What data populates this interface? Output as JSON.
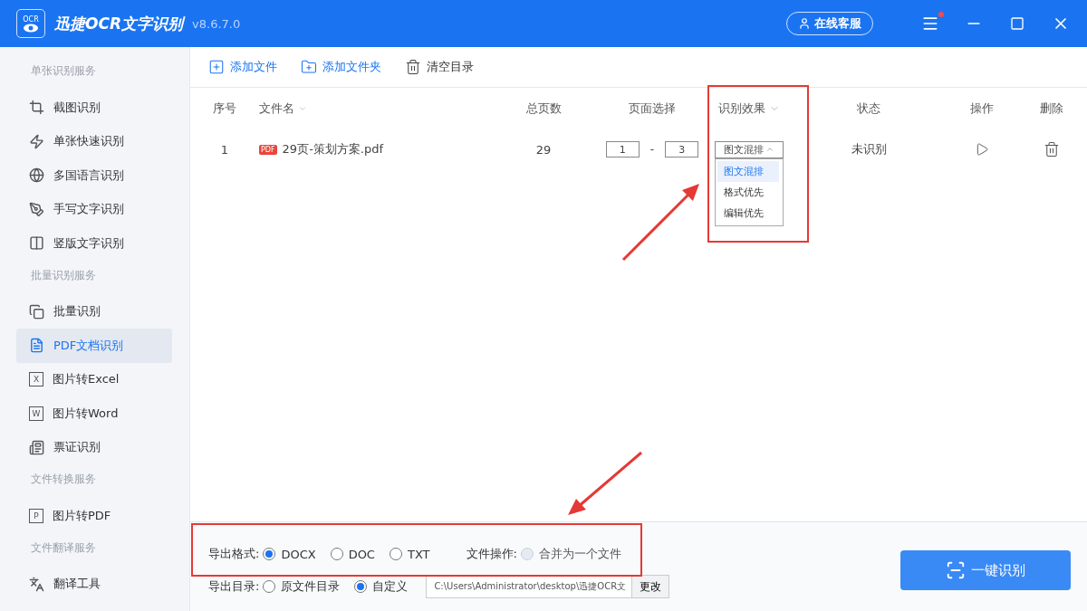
{
  "window": {
    "logo_text": "OCR",
    "title": "迅捷OCR文字识别",
    "version": "v8.6.7.0",
    "support_button": "在线客服",
    "menu_badge": true
  },
  "sidebar": {
    "sections": [
      {
        "heading": "单张识别服务",
        "items": [
          {
            "label": "截图识别",
            "selected": false
          },
          {
            "label": "单张快速识别",
            "selected": false
          },
          {
            "label": "多国语言识别",
            "selected": false
          },
          {
            "label": "手写文字识别",
            "selected": false
          },
          {
            "label": "竖版文字识别",
            "selected": false
          }
        ]
      },
      {
        "heading": "批量识别服务",
        "items": [
          {
            "label": "批量识别",
            "selected": false
          },
          {
            "label": "PDF文档识别",
            "selected": true
          },
          {
            "label": "图片转Excel",
            "selected": false,
            "icon_letter": "X"
          },
          {
            "label": "图片转Word",
            "selected": false,
            "icon_letter": "W"
          },
          {
            "label": "票证识别",
            "selected": false
          }
        ]
      },
      {
        "heading": "文件转换服务",
        "items": [
          {
            "label": "图片转PDF",
            "selected": false,
            "icon_letter": "P"
          }
        ]
      },
      {
        "heading": "文件翻译服务",
        "items": [
          {
            "label": "翻译工具",
            "selected": false
          }
        ]
      }
    ]
  },
  "toolbar": [
    "添加文件",
    "添加文件夹",
    "清空目录"
  ],
  "table": {
    "columns": [
      "序号",
      "文件名",
      "总页数",
      "页面选择",
      "识别效果",
      "状态",
      "操作",
      "删除"
    ],
    "rows": [
      {
        "index": "1",
        "file_badge": "PDF",
        "file": "29页-策划方案.pdf",
        "pages": "29",
        "page_from": "1",
        "range_sep": "-",
        "page_to": "3",
        "mode": "图文混排",
        "status": "未识别"
      }
    ]
  },
  "dropdown": {
    "options": [
      {
        "label": "图文混排",
        "selected": true
      },
      {
        "label": "格式优先",
        "selected": false
      },
      {
        "label": "编辑优先",
        "selected": false
      }
    ]
  },
  "export": {
    "format_label": "导出格式:",
    "formats": [
      {
        "label": "DOCX",
        "selected": true
      },
      {
        "label": "DOC",
        "selected": false
      },
      {
        "label": "TXT",
        "selected": false
      }
    ],
    "file_op_label": "文件操作:",
    "merge": {
      "label": "合并为一个文件",
      "checked": false,
      "disabled": true
    },
    "dir_label": "导出目录:",
    "dirs": [
      {
        "label": "原文件目录",
        "selected": false
      },
      {
        "label": "自定义",
        "selected": true
      }
    ],
    "path": "C:\\Users\\Administrator\\desktop\\迅捷OCR文",
    "change_button": "更改"
  },
  "start_button": "一键识别"
}
